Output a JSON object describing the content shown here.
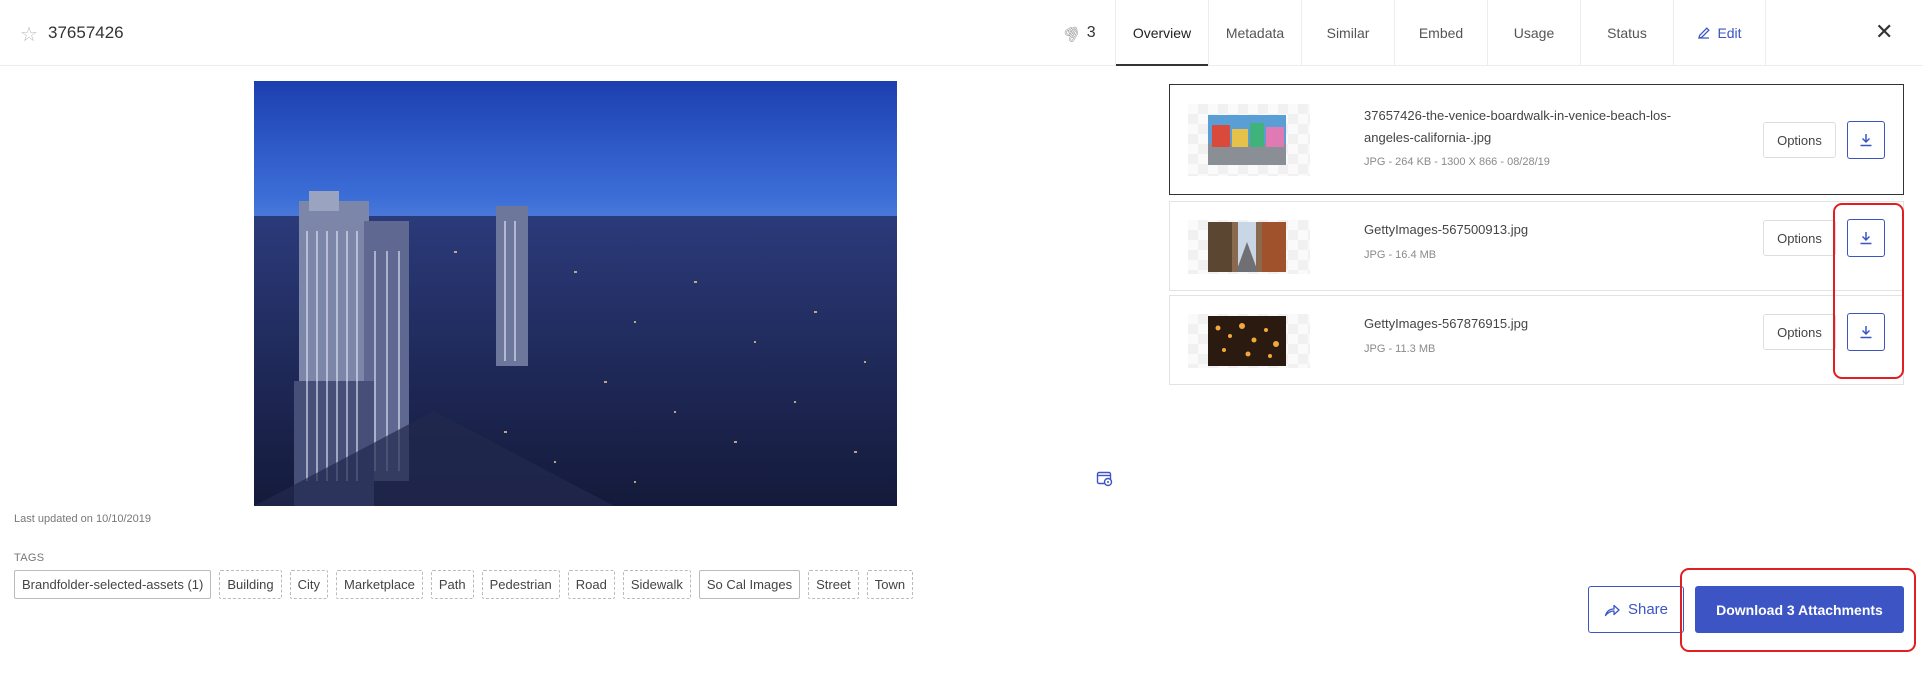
{
  "header": {
    "asset_id": "37657426",
    "attachment_count": "3",
    "tabs": [
      {
        "label": "Overview",
        "active": true
      },
      {
        "label": "Metadata",
        "active": false
      },
      {
        "label": "Similar",
        "active": false
      },
      {
        "label": "Embed",
        "active": false
      },
      {
        "label": "Usage",
        "active": false
      },
      {
        "label": "Status",
        "active": false
      },
      {
        "label": "Edit",
        "active": false
      }
    ],
    "icons": {
      "favorite": "star-outline-icon",
      "attachment": "paperclip-icon",
      "edit": "pencil-icon",
      "close": "close-icon"
    }
  },
  "preview": {
    "last_updated": "Last updated on 10/10/2019",
    "tags_label": "TAGS",
    "tags": [
      "Brandfolder-selected-assets (1)",
      "Building",
      "City",
      "Marketplace",
      "Path",
      "Pedestrian",
      "Road",
      "Sidewalk",
      "So Cal Images",
      "Street",
      "Town"
    ]
  },
  "attachments": [
    {
      "filename": "37657426-the-venice-boardwalk-in-venice-beach-los-angeles-california-.jpg",
      "meta": "JPG - 264 KB - 1300 X 866 - 08/28/19",
      "options_label": "Options",
      "selected": true
    },
    {
      "filename": "GettyImages-567500913.jpg",
      "meta": "JPG - 16.4 MB",
      "options_label": "Options",
      "selected": false
    },
    {
      "filename": "GettyImages-567876915.jpg",
      "meta": "JPG - 11.3 MB",
      "options_label": "Options",
      "selected": false
    }
  ],
  "actions": {
    "share_label": "Share",
    "download_all_label": "Download 3 Attachments"
  },
  "colors": {
    "accent": "#3d55c4",
    "annotation": "#e02020"
  }
}
